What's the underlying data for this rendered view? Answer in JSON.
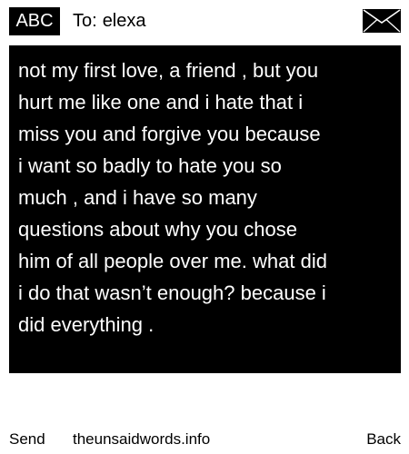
{
  "header": {
    "mode_label": "ABC",
    "to_prefix": "To:",
    "recipient": "elexa",
    "envelope_icon": "envelope-icon"
  },
  "message": {
    "text": "not my first love, a friend , but you\nhurt me like one and i hate that i\nmiss you and forgive you because\ni want so badly to hate you so\nmuch , and i have so many\nquestions about why you chose\nhim of all people over me. what did\ni do that wasn’t enough? because i\ndid everything ."
  },
  "footer": {
    "send_label": "Send",
    "site_label": "theunsaidwords.info",
    "back_label": "Back"
  },
  "colors": {
    "background": "#ffffff",
    "message_background": "#000000",
    "message_text": "#ffffff"
  }
}
